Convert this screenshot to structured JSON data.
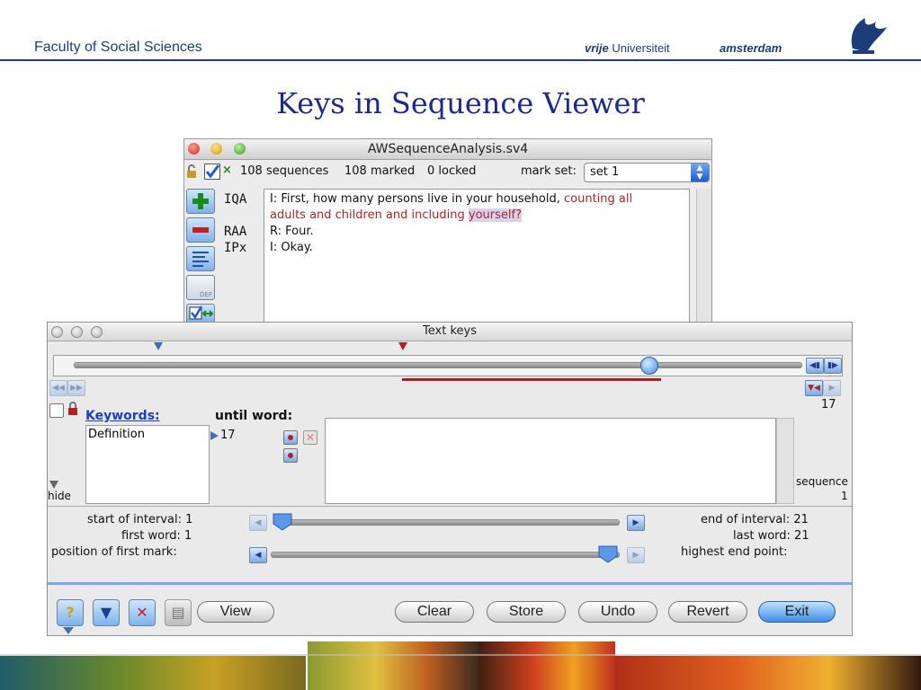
{
  "slide": {
    "header_left": "Faculty of Social Sciences",
    "header_vu_italic": "vrije",
    "header_vu": "Universiteit",
    "header_city": "amsterdam",
    "title": "Keys in Sequence Viewer"
  },
  "seq_window": {
    "title": "AWSequenceAnalysis.sv4",
    "sequences": "108 sequences",
    "marked": "108 marked",
    "locked": "0 locked",
    "mark_set_label": "mark set:",
    "mark_set_value": "set 1",
    "codes": [
      "IQA",
      "",
      "RAA",
      "IPx"
    ],
    "lines": [
      {
        "plain": "I: First, how many persons live in your household, ",
        "red": "counting all"
      },
      {
        "red": "adults and children and including ",
        "highlight": "yourself?"
      },
      {
        "plain": "R: Four."
      },
      {
        "plain": "I: Okay."
      }
    ],
    "def_icon_label": "DEF"
  },
  "keys_window": {
    "title": "Text keys",
    "count_right": "17",
    "keywords_label": "Keywords:",
    "until_word_label": "until word:",
    "definition_item": "Definition",
    "until_value": "17",
    "hide_label": "hide",
    "sequence_label": "sequence",
    "sequence_value": "1",
    "start_of_interval": "start of interval: 1",
    "first_word": "first word: 1",
    "position_first_mark": "position of first mark:",
    "end_of_interval": "end of interval: 21",
    "last_word": "last word: 21",
    "highest_end_point": "highest end point:",
    "buttons": {
      "view": "View",
      "clear": "Clear",
      "store": "Store",
      "undo": "Undo",
      "revert": "Revert",
      "exit": "Exit"
    }
  },
  "colors": {
    "brand_blue": "#1c3d7a",
    "title_blue": "#1a2a8c",
    "highlight_red": "#b22222",
    "aqua": "#3f8fe6"
  }
}
